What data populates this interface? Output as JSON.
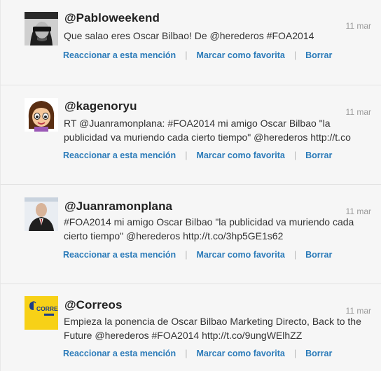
{
  "mentions": [
    {
      "handle": "@Pabloweekend",
      "date": "11 mar",
      "text": "Que salao eres Oscar Bilbao! De @herederos #FOA2014",
      "actions": {
        "reply": "Reaccionar a esta mención",
        "favorite": "Marcar como favorita",
        "delete": "Borrar"
      }
    },
    {
      "handle": "@kagenoryu",
      "date": "11 mar",
      "text": "RT @Juanramonplana: #FOA2014 mi amigo Oscar Bilbao \"la publicidad va muriendo cada cierto tiempo\" @herederos http://t.co",
      "actions": {
        "reply": "Reaccionar a esta mención",
        "favorite": "Marcar como favorita",
        "delete": "Borrar"
      }
    },
    {
      "handle": "@Juanramonplana",
      "date": "11 mar",
      "text": "#FOA2014 mi amigo Oscar Bilbao \"la publicidad va muriendo cada cierto tiempo\" @herederos http://t.co/3hp5GE1s62",
      "actions": {
        "reply": "Reaccionar a esta mención",
        "favorite": "Marcar como favorita",
        "delete": "Borrar"
      }
    },
    {
      "handle": "@Correos",
      "date": "11 mar",
      "text": "Empieza la ponencia de Oscar Bilbao Marketing Directo, Back to the Future @herederos #FOA2014 http://t.co/9ungWElhZZ",
      "actions": {
        "reply": "Reaccionar a esta mención",
        "favorite": "Marcar como favorita",
        "delete": "Borrar"
      },
      "avatar_logo": "CORREOS"
    }
  ],
  "colors": {
    "link": "#2b7bb9",
    "background": "#f6f6f6",
    "correos_yellow": "#f7d117"
  }
}
